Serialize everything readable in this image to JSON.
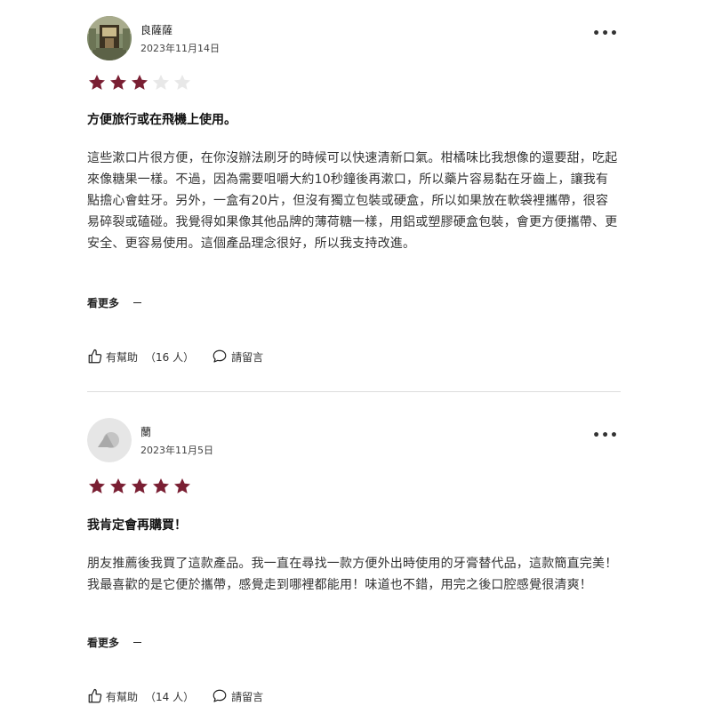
{
  "colors": {
    "star_filled": "#7a1f33",
    "star_empty": "#e8e8e8",
    "divider": "#dddddd"
  },
  "reviews": [
    {
      "author": "良薩薩",
      "date": "2023年11月14日",
      "menu_icon": "more-horizontal-icon",
      "menu_label": "•••",
      "rating": 3,
      "max_rating": 5,
      "title": "方便旅行或在飛機上使用。",
      "body": "這些漱口片很方便，在你沒辦法刷牙的時候可以快速清新口氣。柑橘味比我想像的還要甜，吃起來像糖果一樣。不過，因為需要咀嚼大約10秒鐘後再漱口，所以藥片容易黏在牙齒上，讓我有點擔心會蛀牙。另外，一盒有20片，但沒有獨立包裝或硬盒，所以如果放在軟袋裡攜帶，很容易碎裂或磕碰。我覺得如果像其他品牌的薄荷糖一樣，用鋁或塑膠硬盒包裝，會更方便攜帶、更安全、更容易使用。這個產品理念很好，所以我支持改進。",
      "read_more": "看更多",
      "helpful_label": "有幫助",
      "helpful_count": "（16 人）",
      "comment_label": "請留言"
    },
    {
      "author": "蘭",
      "date": "2023年11月5日",
      "menu_icon": "more-horizontal-icon",
      "menu_label": "•••",
      "rating": 5,
      "max_rating": 5,
      "title": "我肯定會再購買！",
      "body": "朋友推薦後我買了這款產品。我一直在尋找一款方便外出時使用的牙膏替代品，這款簡直完美！我最喜歡的是它便於攜帶，感覺走到哪裡都能用！味道也不錯，用完之後口腔感覺很清爽！",
      "read_more": "看更多",
      "helpful_label": "有幫助",
      "helpful_count": "（14 人）",
      "comment_label": "請留言"
    }
  ]
}
